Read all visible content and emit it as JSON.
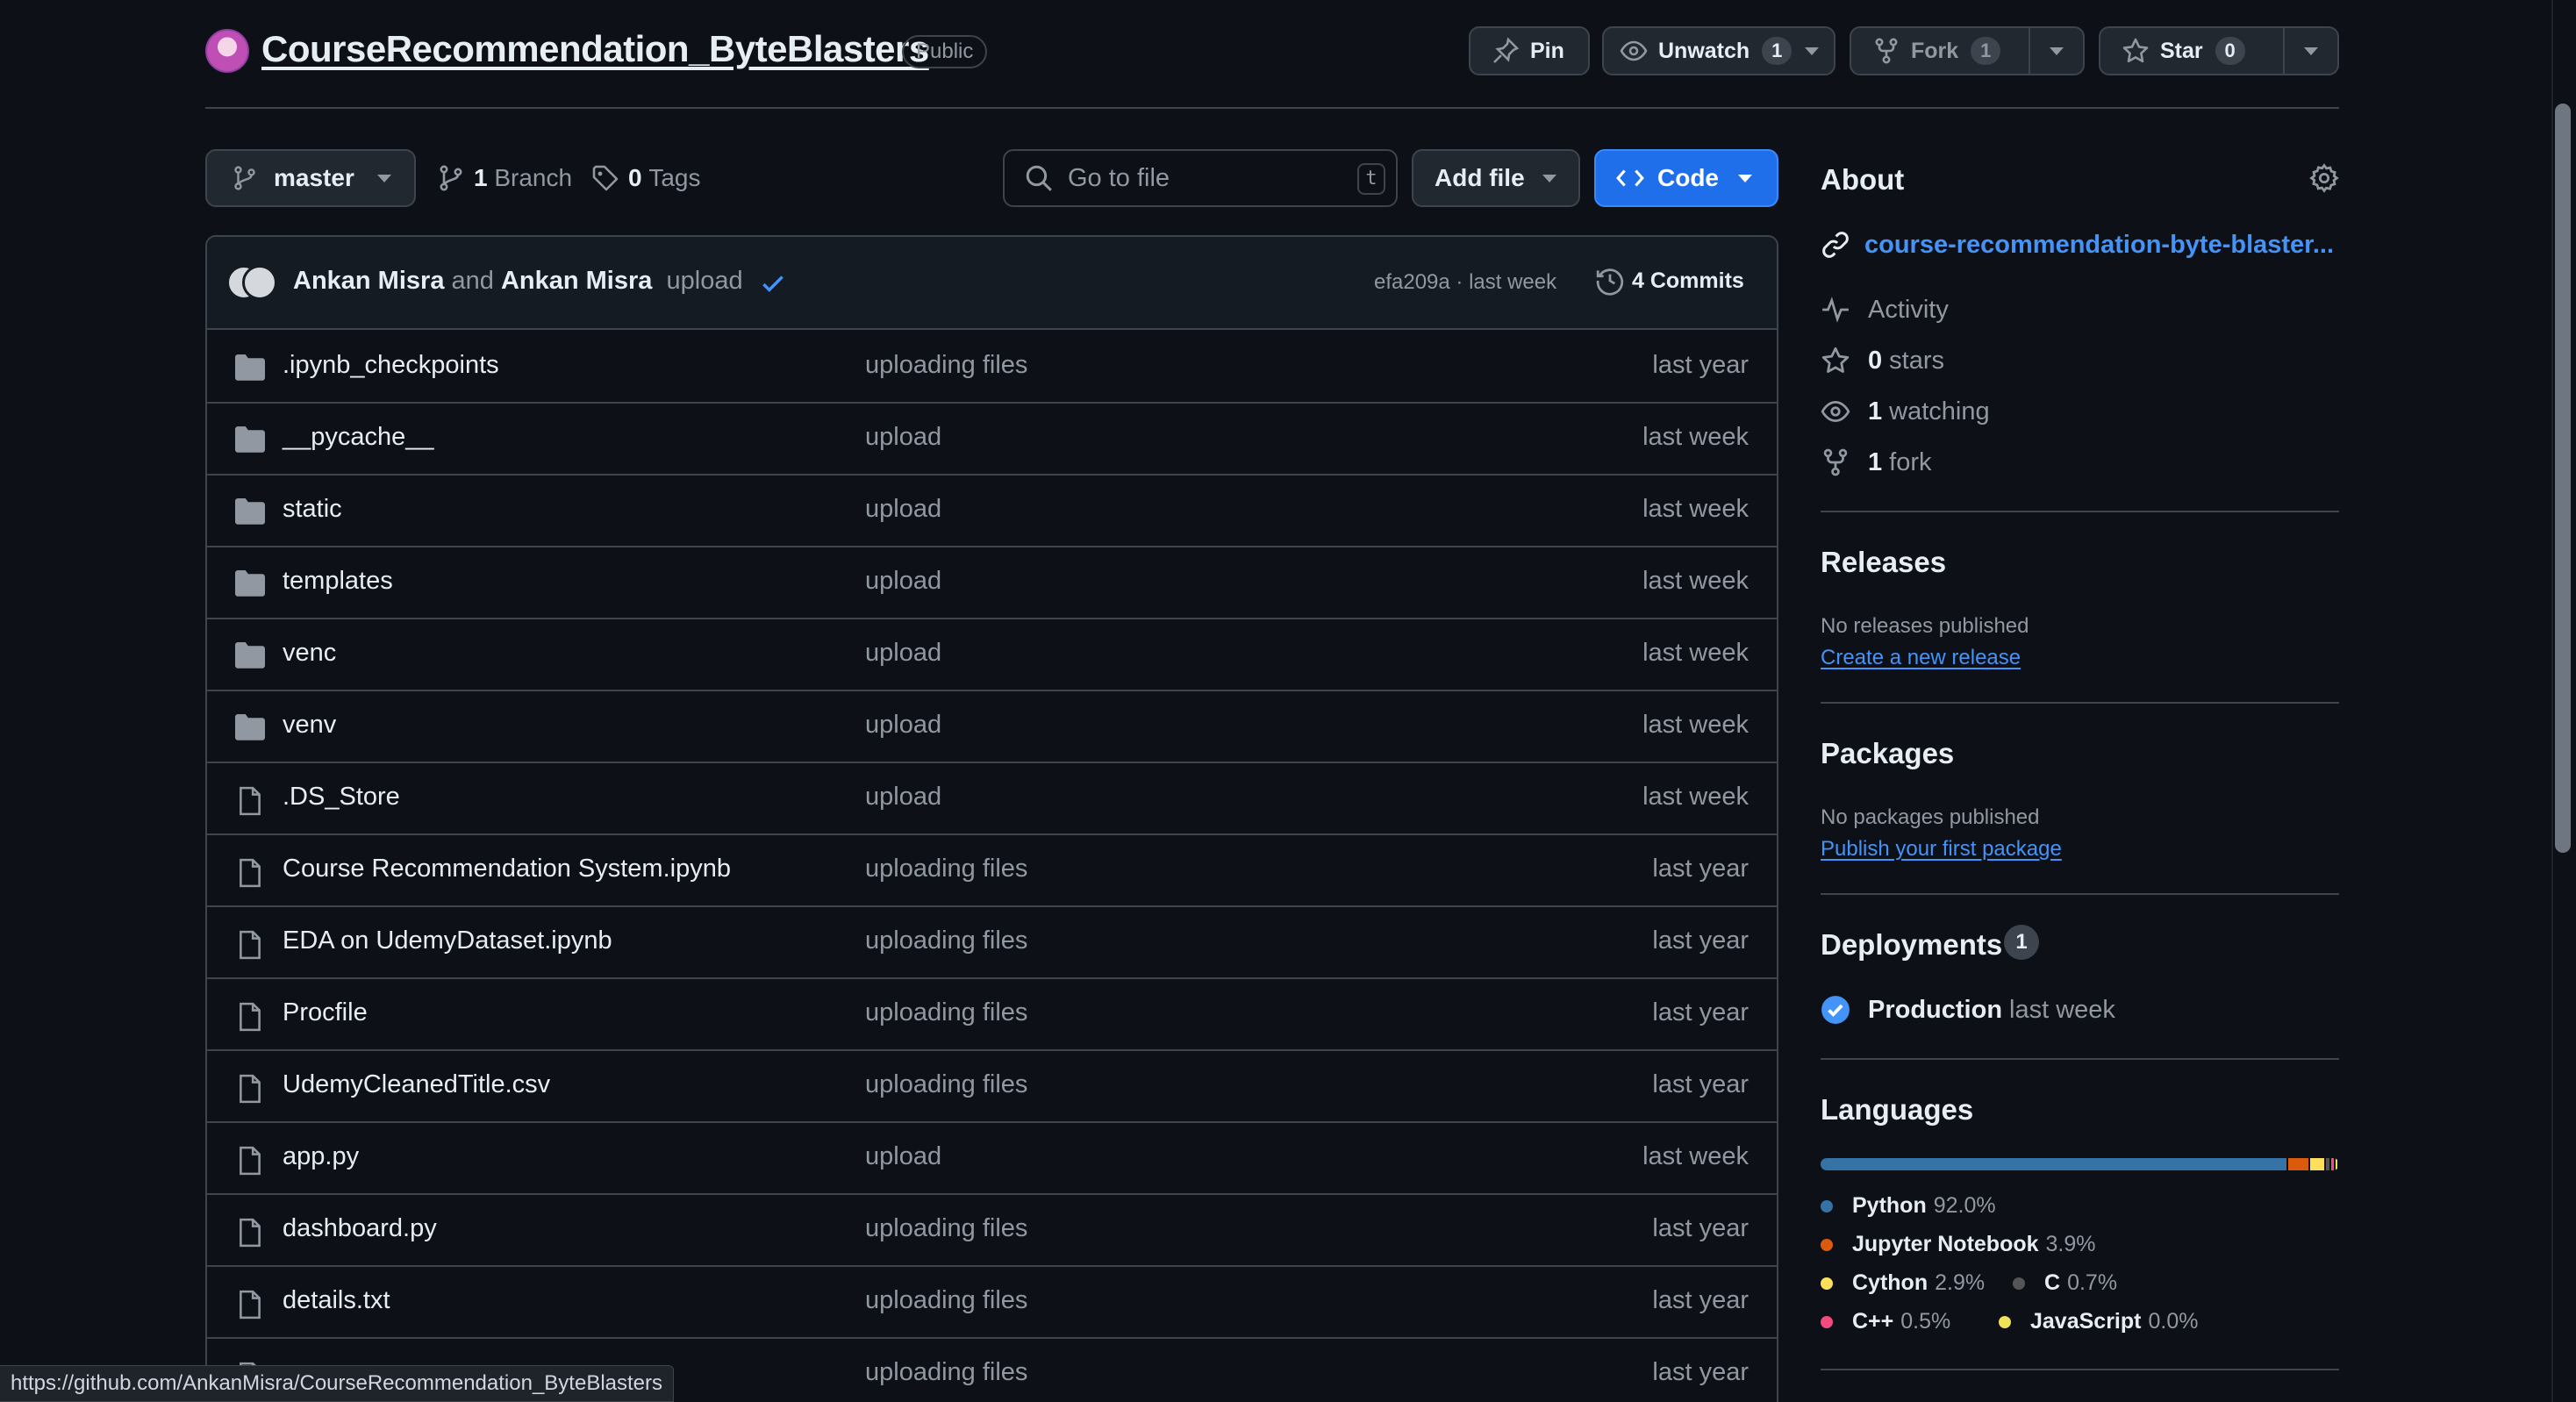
{
  "repo": {
    "name": "CourseRecommendation_ByteBlasters",
    "visibility": "Public"
  },
  "header_actions": {
    "pin_label": "Pin",
    "unwatch_label": "Unwatch",
    "watch_count": "1",
    "fork_label": "Fork",
    "fork_count": "1",
    "star_label": "Star",
    "star_count": "0"
  },
  "toolbar": {
    "branch": "master",
    "branch_count": "1",
    "branch_label": "Branch",
    "tag_count": "0",
    "tag_label": "Tags",
    "search_placeholder": "Go to file",
    "search_shortcut": "t",
    "add_file_label": "Add file",
    "code_label": "Code"
  },
  "latest_commit": {
    "author1": "Ankan Misra",
    "joiner": "and",
    "author2": "Ankan Misra",
    "message": "upload",
    "hash_time": "efa209a · last week",
    "commits_label": "4 Commits"
  },
  "files": [
    {
      "type": "dir",
      "name": ".ipynb_checkpoints",
      "message": "uploading files",
      "time": "last year"
    },
    {
      "type": "dir",
      "name": "__pycache__",
      "message": "upload",
      "time": "last week"
    },
    {
      "type": "dir",
      "name": "static",
      "message": "upload",
      "time": "last week"
    },
    {
      "type": "dir",
      "name": "templates",
      "message": "upload",
      "time": "last week"
    },
    {
      "type": "dir",
      "name": "venc",
      "message": "upload",
      "time": "last week"
    },
    {
      "type": "dir",
      "name": "venv",
      "message": "upload",
      "time": "last week"
    },
    {
      "type": "file",
      "name": ".DS_Store",
      "message": "upload",
      "time": "last week"
    },
    {
      "type": "file",
      "name": "Course Recommendation System.ipynb",
      "message": "uploading files",
      "time": "last year"
    },
    {
      "type": "file",
      "name": "EDA on UdemyDataset.ipynb",
      "message": "uploading files",
      "time": "last year"
    },
    {
      "type": "file",
      "name": "Procfile",
      "message": "uploading files",
      "time": "last year"
    },
    {
      "type": "file",
      "name": "UdemyCleanedTitle.csv",
      "message": "uploading files",
      "time": "last year"
    },
    {
      "type": "file",
      "name": "app.py",
      "message": "upload",
      "time": "last week"
    },
    {
      "type": "file",
      "name": "dashboard.py",
      "message": "uploading files",
      "time": "last year"
    },
    {
      "type": "file",
      "name": "details.txt",
      "message": "uploading files",
      "time": "last year"
    },
    {
      "type": "file",
      "name": "",
      "message": "uploading files",
      "time": "last year"
    }
  ],
  "about": {
    "title": "About",
    "link": "course-recommendation-byte-blaster...",
    "activity": "Activity",
    "stars_count": "0",
    "stars_label": "stars",
    "watching_count": "1",
    "watching_label": "watching",
    "fork_count": "1",
    "fork_label": "fork"
  },
  "releases": {
    "title": "Releases",
    "note": "No releases published",
    "link": "Create a new release"
  },
  "packages": {
    "title": "Packages",
    "note": "No packages published",
    "link": "Publish your first package"
  },
  "deployments": {
    "title": "Deployments",
    "count": "1",
    "env": "Production",
    "time": "last week"
  },
  "languages": {
    "title": "Languages",
    "items": [
      {
        "name": "Python",
        "percent": "92.0%",
        "value": 92.0,
        "color": "#3572A5"
      },
      {
        "name": "Jupyter Notebook",
        "percent": "3.9%",
        "value": 3.9,
        "color": "#DA5B0B"
      },
      {
        "name": "Cython",
        "percent": "2.9%",
        "value": 2.9,
        "color": "#fedf5b"
      },
      {
        "name": "C",
        "percent": "0.7%",
        "value": 0.7,
        "color": "#555555"
      },
      {
        "name": "C++",
        "percent": "0.5%",
        "value": 0.5,
        "color": "#f34b7d"
      },
      {
        "name": "JavaScript",
        "percent": "0.0%",
        "value": 0.0,
        "color": "#f1e05a"
      }
    ]
  },
  "status_url": "https://github.com/AnkanMisra/CourseRecommendation_ByteBlasters",
  "colors": {
    "background": "#0d1117",
    "border": "#3d444d",
    "accent_link": "#4493f8",
    "primary_button": "#1f6feb",
    "muted_text": "#9198a1"
  }
}
